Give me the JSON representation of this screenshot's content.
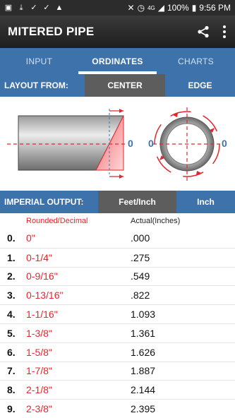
{
  "status_bar": {
    "battery": "100%",
    "time": "9:56 PM",
    "network": "4G"
  },
  "app": {
    "title": "MITERED PIPE"
  },
  "tabs": [
    {
      "label": "INPUT"
    },
    {
      "label": "ORDINATES"
    },
    {
      "label": "CHARTS"
    }
  ],
  "active_tab": "ORDINATES",
  "layout_from": {
    "label": "LAYOUT FROM:",
    "options": [
      "CENTER",
      "EDGE"
    ],
    "selected": "CENTER"
  },
  "diagram": {
    "pipe_side_label": "0",
    "ring_left_label": "0",
    "ring_right_label": "0"
  },
  "imperial_output": {
    "label": "IMPERIAL OUTPUT:",
    "options": [
      "Feet/Inch",
      "Inch"
    ],
    "selected": "Feet/Inch"
  },
  "table": {
    "headers": {
      "rounded": "Rounded/Decimal",
      "actual": "Actual(Inches)"
    },
    "rows": [
      {
        "index": "0.",
        "rounded": "0\"",
        "actual": ".000"
      },
      {
        "index": "1.",
        "rounded": "0-1/4\"",
        "actual": ".275"
      },
      {
        "index": "2.",
        "rounded": "0-9/16\"",
        "actual": ".549"
      },
      {
        "index": "3.",
        "rounded": "0-13/16\"",
        "actual": ".822"
      },
      {
        "index": "4.",
        "rounded": "1-1/16\"",
        "actual": "1.093"
      },
      {
        "index": "5.",
        "rounded": "1-3/8\"",
        "actual": "1.361"
      },
      {
        "index": "6.",
        "rounded": "1-5/8\"",
        "actual": "1.626"
      },
      {
        "index": "7.",
        "rounded": "1-7/8\"",
        "actual": "1.887"
      },
      {
        "index": "8.",
        "rounded": "2-1/8\"",
        "actual": "2.144"
      },
      {
        "index": "9.",
        "rounded": "2-3/8\"",
        "actual": "2.395"
      }
    ]
  },
  "colors": {
    "accent_blue": "#3e72ab",
    "selected_gray": "#5d5d5d",
    "red": "#e0282e"
  }
}
